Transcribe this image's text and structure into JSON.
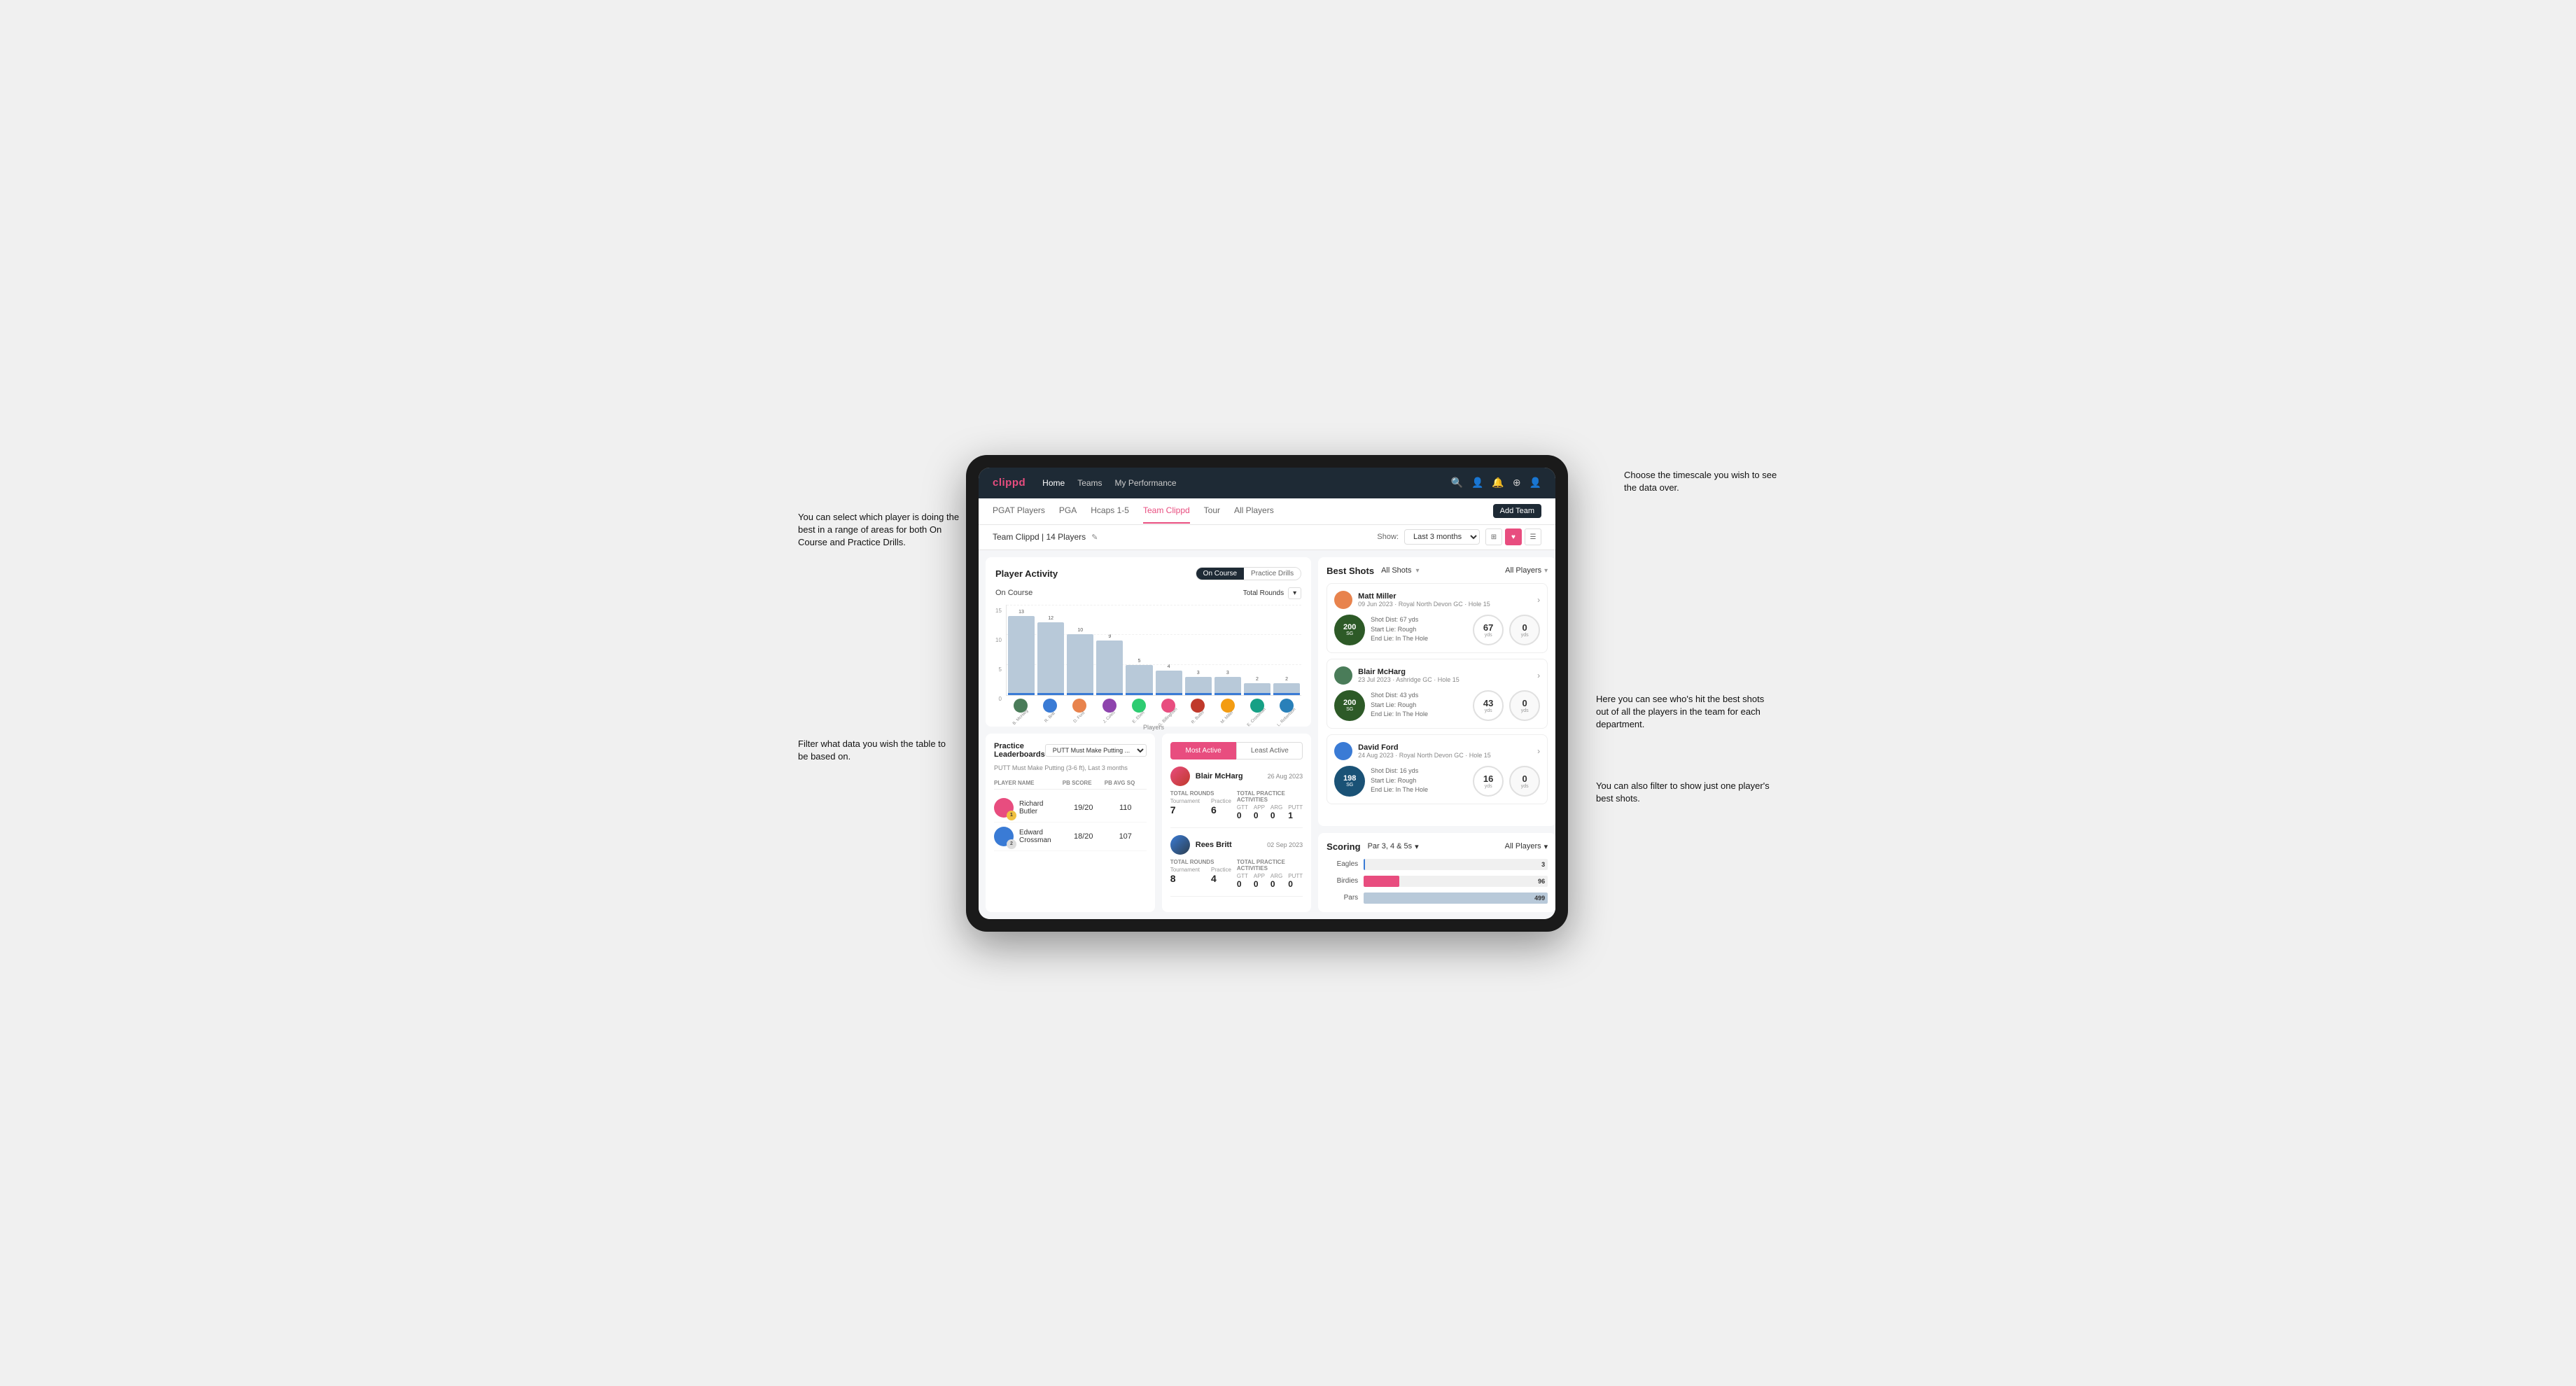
{
  "annotations": {
    "top_right": "Choose the timescale you wish to see the data over.",
    "top_left": "You can select which player is doing the best in a range of areas for both On Course and Practice Drills.",
    "bottom_left": "Filter what data you wish the table to be based on.",
    "right_1": "Here you can see who's hit the best shots out of all the players in the team for each department.",
    "right_2": "You can also filter to show just one player's best shots."
  },
  "nav": {
    "logo": "clippd",
    "links": [
      "Home",
      "Teams",
      "My Performance"
    ],
    "tabs": [
      "PGAT Players",
      "PGA",
      "Hcaps 1-5",
      "Team Clippd",
      "Tour",
      "All Players"
    ],
    "active_tab": "Team Clippd",
    "add_team_label": "Add Team",
    "team_name": "Team Clippd | 14 Players",
    "show_label": "Show:",
    "time_filter": "Last 3 months",
    "views": [
      "grid",
      "heart",
      "list"
    ]
  },
  "player_activity": {
    "title": "Player Activity",
    "toggle_on": "On Course",
    "toggle_practice": "Practice Drills",
    "section_label": "On Course",
    "chart_label": "Total Rounds",
    "x_label": "Players",
    "y_values": [
      "15",
      "10",
      "5",
      "0"
    ],
    "bars": [
      {
        "name": "B. McHarg",
        "value": 13,
        "height_pct": 87
      },
      {
        "name": "R. Britt",
        "value": 12,
        "height_pct": 80
      },
      {
        "name": "D. Ford",
        "value": 10,
        "height_pct": 67
      },
      {
        "name": "J. Coles",
        "value": 9,
        "height_pct": 60
      },
      {
        "name": "E. Ebert",
        "value": 5,
        "height_pct": 33
      },
      {
        "name": "G. Billingham",
        "value": 4,
        "height_pct": 27
      },
      {
        "name": "R. Butler",
        "value": 3,
        "height_pct": 20
      },
      {
        "name": "M. Miller",
        "value": 3,
        "height_pct": 20
      },
      {
        "name": "E. Crossman",
        "value": 2,
        "height_pct": 13
      },
      {
        "name": "L. Robertson",
        "value": 2,
        "height_pct": 13
      }
    ]
  },
  "leaderboard": {
    "title": "Practice Leaderboards",
    "dropdown_label": "PUTT Must Make Putting ...",
    "subtitle": "PUTT Must Make Putting (3-6 ft), Last 3 months",
    "headers": [
      "PLAYER NAME",
      "PB SCORE",
      "PB AVG SQ"
    ],
    "rows": [
      {
        "name": "Richard Butler",
        "badge": "1",
        "pb_score": "19/20",
        "pb_avg": "110"
      },
      {
        "name": "Edward Crossman",
        "badge": "2",
        "pb_score": "18/20",
        "pb_avg": "107"
      }
    ]
  },
  "most_active": {
    "tab_active": "Most Active",
    "tab_least": "Least Active",
    "players": [
      {
        "name": "Blair McHarg",
        "date": "26 Aug 2023",
        "total_rounds_label": "Total Rounds",
        "tournament": "7",
        "practice": "6",
        "activities_label": "Total Practice Activities",
        "gtt": "0",
        "app": "0",
        "arg": "0",
        "putt": "1"
      },
      {
        "name": "Rees Britt",
        "date": "02 Sep 2023",
        "total_rounds_label": "Total Rounds",
        "tournament": "8",
        "practice": "4",
        "activities_label": "Total Practice Activities",
        "gtt": "0",
        "app": "0",
        "arg": "0",
        "putt": "0"
      }
    ]
  },
  "best_shots": {
    "title": "Best Shots",
    "filter_label": "All Shots",
    "players_label": "All Players",
    "shots": [
      {
        "player": "Matt Miller",
        "date": "09 Jun 2023",
        "course": "Royal North Devon GC",
        "hole": "Hole 15",
        "badge_num": "200",
        "badge_sub": "SG",
        "shot_dist": "Shot Dist: 67 yds",
        "start_lie": "Start Lie: Rough",
        "end_lie": "End Lie: In The Hole",
        "yds_val": "67",
        "zero_val": "0"
      },
      {
        "player": "Blair McHarg",
        "date": "23 Jul 2023",
        "course": "Ashridge GC",
        "hole": "Hole 15",
        "badge_num": "200",
        "badge_sub": "SG",
        "shot_dist": "Shot Dist: 43 yds",
        "start_lie": "Start Lie: Rough",
        "end_lie": "End Lie: In The Hole",
        "yds_val": "43",
        "zero_val": "0"
      },
      {
        "player": "David Ford",
        "date": "24 Aug 2023",
        "course": "Royal North Devon GC",
        "hole": "Hole 15",
        "badge_num": "198",
        "badge_sub": "SG",
        "shot_dist": "Shot Dist: 16 yds",
        "start_lie": "Start Lie: Rough",
        "end_lie": "End Lie: In The Hole",
        "yds_val": "16",
        "zero_val": "0"
      }
    ]
  },
  "scoring": {
    "title": "Scoring",
    "filter_label": "Par 3, 4 & 5s",
    "players_label": "All Players",
    "rows": [
      {
        "label": "Eagles",
        "value": 3,
        "max": 500,
        "color": "#3a7bd5"
      },
      {
        "label": "Birdies",
        "value": 96,
        "max": 500,
        "color": "#e84d7f"
      },
      {
        "label": "Pars",
        "value": 499,
        "max": 500,
        "color": "#b8c9d9"
      }
    ]
  }
}
